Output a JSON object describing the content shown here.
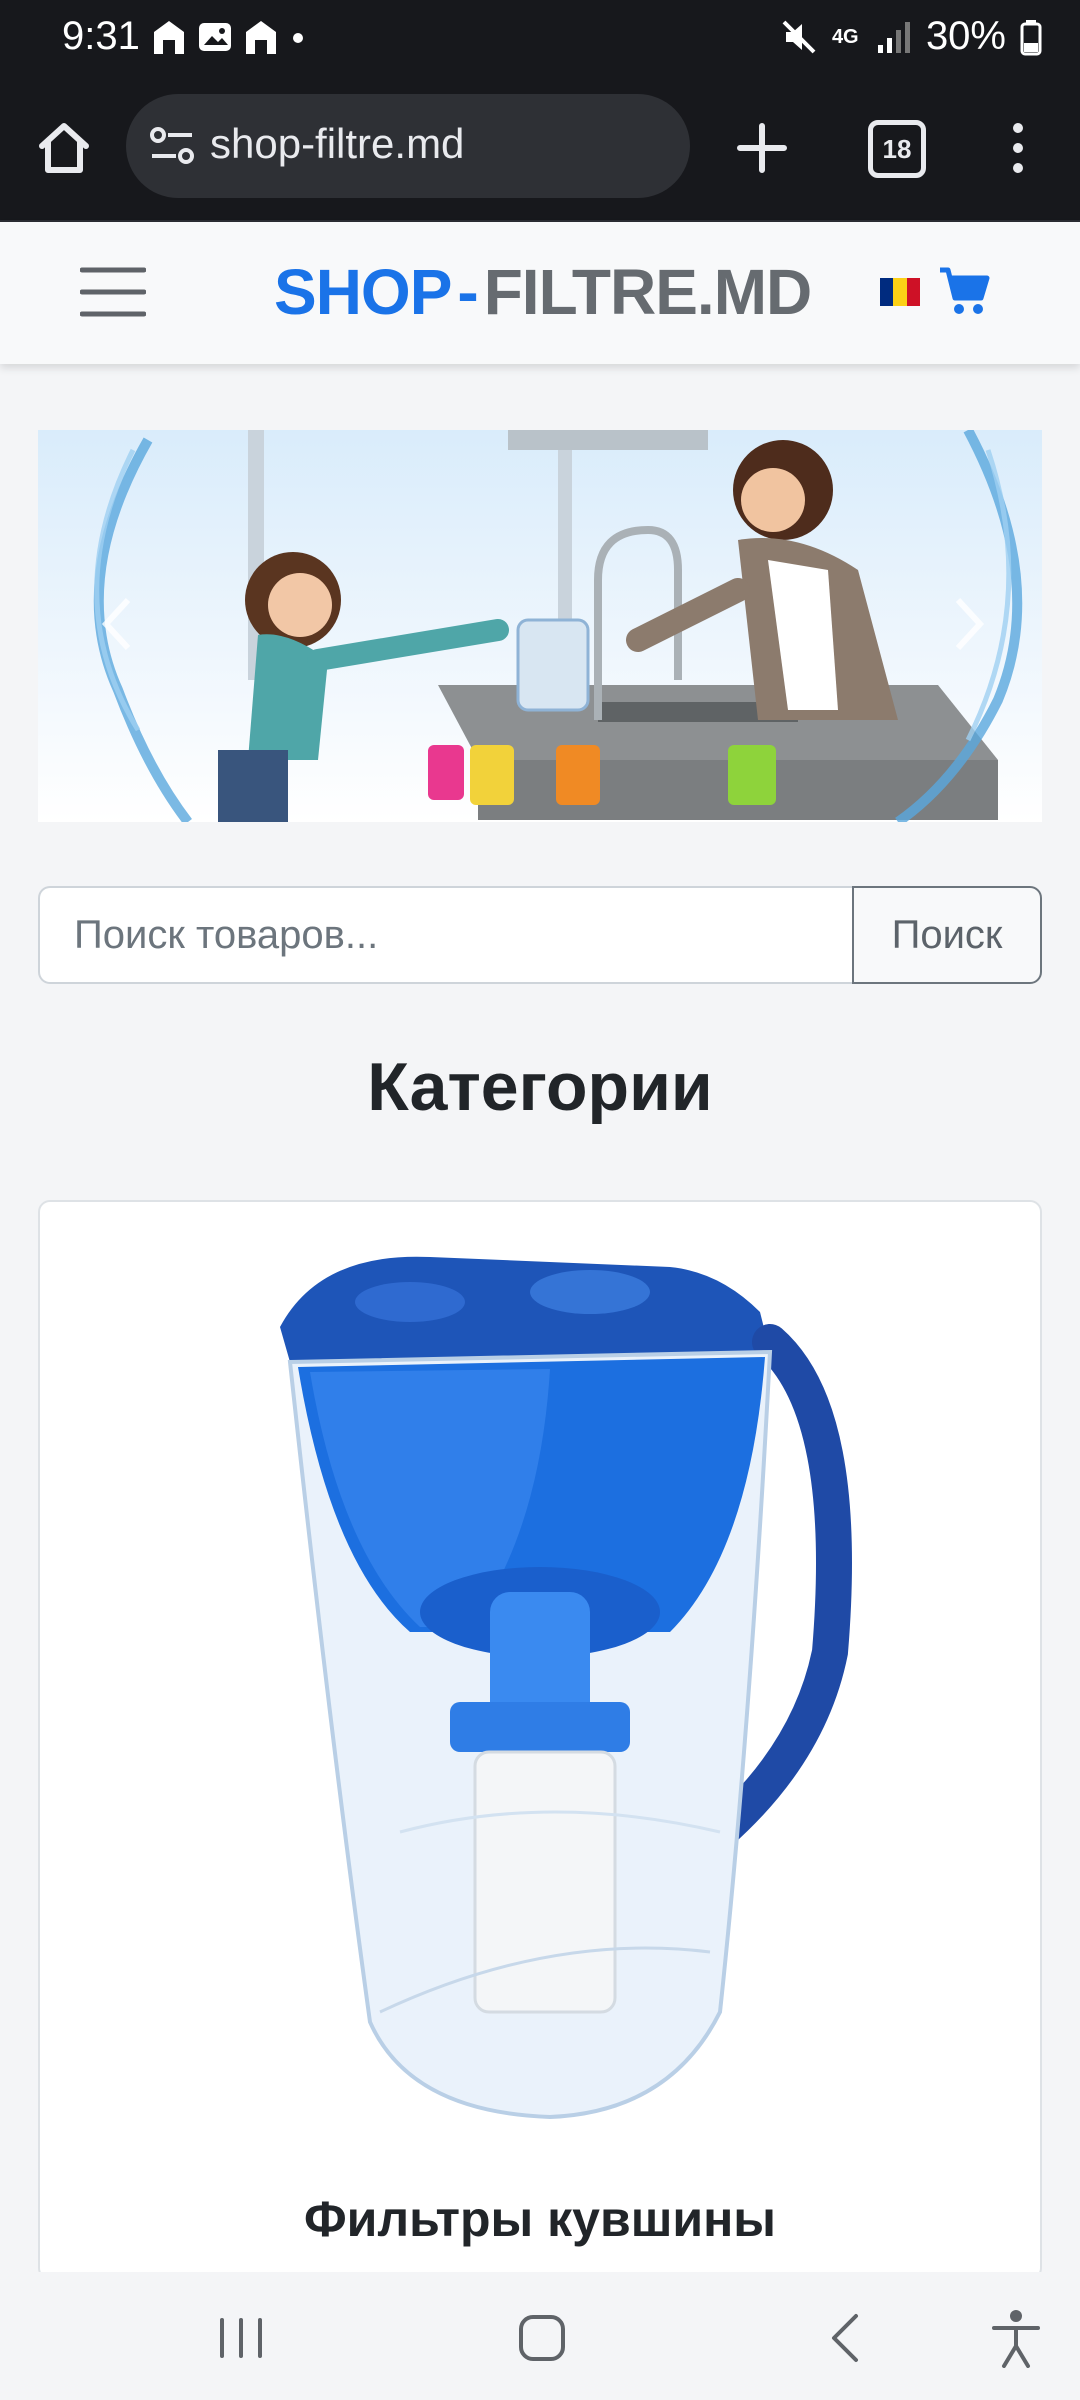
{
  "status_bar": {
    "time": "9:31",
    "network": "4G",
    "battery": "30%"
  },
  "browser": {
    "url": "shop-filtre.md",
    "tab_count": "18"
  },
  "header": {
    "brand_part1": "SHOP",
    "brand_separator": "-",
    "brand_part2": "FILTRE.MD",
    "language_flag": "Romanian flag",
    "colors": {
      "brand_blue": "#1a73e8",
      "brand_gray": "#666b70"
    }
  },
  "search": {
    "placeholder": "Поиск товаров...",
    "button_label": "Поиск"
  },
  "categories": {
    "title": "Категории",
    "items": [
      {
        "name": "Фильтры кувшины",
        "icon": "water-filter-pitcher-image"
      }
    ]
  }
}
